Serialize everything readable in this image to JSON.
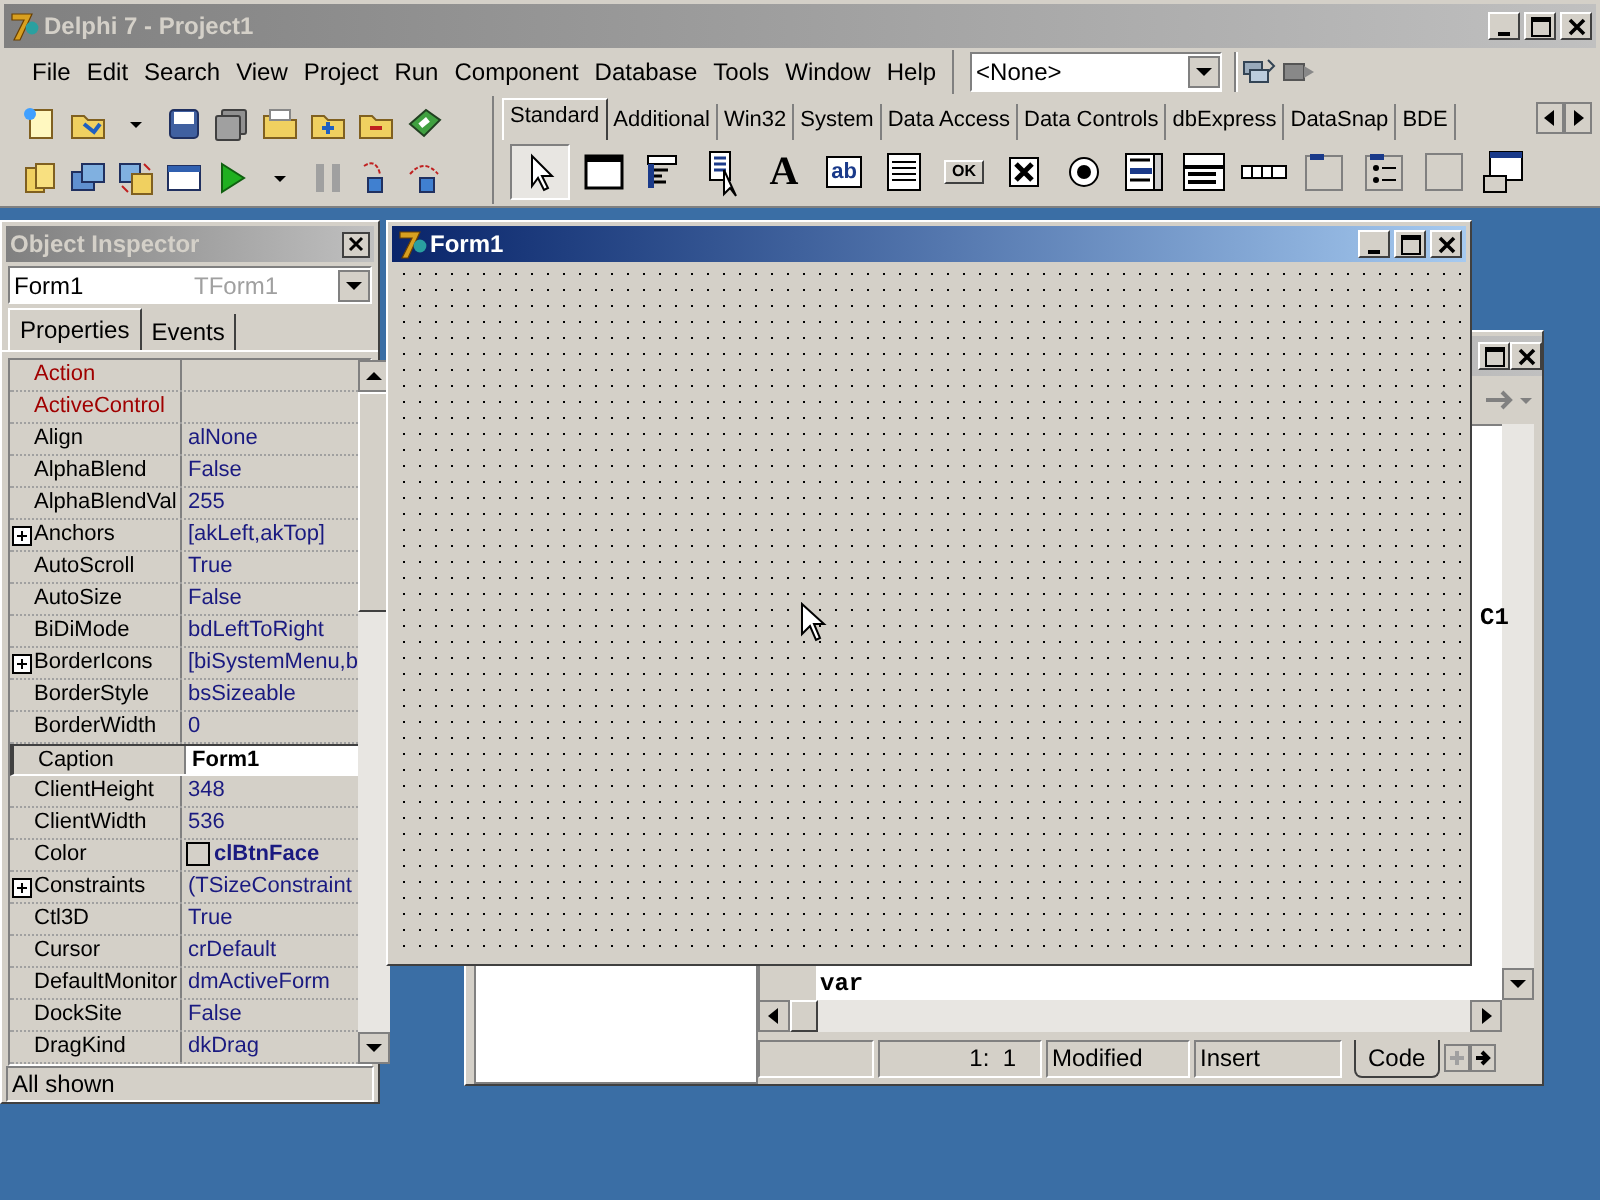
{
  "main_window": {
    "title": "Delphi 7 - Project1",
    "menu": [
      "File",
      "Edit",
      "Search",
      "View",
      "Project",
      "Run",
      "Component",
      "Database",
      "Tools",
      "Window",
      "Help"
    ],
    "component_combo": {
      "value": "<None>"
    },
    "palette_tabs": [
      {
        "label": "Standard",
        "selected": true
      },
      {
        "label": "Additional",
        "selected": false
      },
      {
        "label": "Win32",
        "selected": false
      },
      {
        "label": "System",
        "selected": false
      },
      {
        "label": "Data Access",
        "selected": false
      },
      {
        "label": "Data Controls",
        "selected": false
      },
      {
        "label": "dbExpress",
        "selected": false
      },
      {
        "label": "DataSnap",
        "selected": false
      },
      {
        "label": "BDE",
        "selected": false
      }
    ],
    "palette_components": [
      {
        "kind": "pointer",
        "selected": true
      },
      {
        "kind": "frame",
        "selected": false
      },
      {
        "kind": "menu",
        "selected": false
      },
      {
        "kind": "popup",
        "selected": false
      },
      {
        "kind": "label",
        "text": "A",
        "selected": false
      },
      {
        "kind": "edit",
        "text": "ab",
        "selected": false
      },
      {
        "kind": "memo",
        "selected": false
      },
      {
        "kind": "button",
        "text": "OK",
        "selected": false
      },
      {
        "kind": "checkbox",
        "selected": false
      },
      {
        "kind": "radio",
        "selected": false
      },
      {
        "kind": "listbox",
        "selected": false
      },
      {
        "kind": "combobox",
        "selected": false
      },
      {
        "kind": "scrollbar",
        "selected": false
      },
      {
        "kind": "groupbox",
        "selected": false
      },
      {
        "kind": "radiogroup",
        "selected": false
      },
      {
        "kind": "panel",
        "selected": false
      },
      {
        "kind": "actionlist",
        "selected": false
      }
    ]
  },
  "object_inspector": {
    "title": "Object Inspector",
    "selector": {
      "name": "Form1",
      "type": "TForm1"
    },
    "tabs": [
      {
        "label": "Properties",
        "selected": true
      },
      {
        "label": "Events",
        "selected": false
      }
    ],
    "properties": [
      {
        "name": "Action",
        "kind": "reference",
        "selected": false
      },
      {
        "name": "ActiveControl",
        "kind": "reference",
        "selected": false
      },
      {
        "name": "Align",
        "value": "alNone",
        "kind": "plain",
        "selected": false
      },
      {
        "name": "AlphaBlend",
        "value": "False",
        "kind": "plain",
        "selected": false
      },
      {
        "name": "AlphaBlendVal",
        "value": "255",
        "kind": "plain",
        "selected": false
      },
      {
        "name": "Anchors",
        "value": "[akLeft,akTop]",
        "kind": "expandable",
        "selected": false
      },
      {
        "name": "AutoScroll",
        "value": "True",
        "kind": "plain",
        "selected": false
      },
      {
        "name": "AutoSize",
        "value": "False",
        "kind": "plain",
        "selected": false
      },
      {
        "name": "BiDiMode",
        "value": "bdLeftToRight",
        "kind": "plain",
        "selected": false
      },
      {
        "name": "BorderIcons",
        "value": "[biSystemMenu,b",
        "kind": "expandable",
        "selected": false
      },
      {
        "name": "BorderStyle",
        "value": "bsSizeable",
        "kind": "plain",
        "selected": false
      },
      {
        "name": "BorderWidth",
        "value": "0",
        "kind": "plain",
        "selected": false
      },
      {
        "name": "Caption",
        "value": "Form1",
        "kind": "plain",
        "selected": true
      },
      {
        "name": "ClientHeight",
        "value": "348",
        "kind": "plain",
        "selected": false
      },
      {
        "name": "ClientWidth",
        "value": "536",
        "kind": "plain",
        "selected": false
      },
      {
        "name": "Color",
        "value": "clBtnFace",
        "kind": "color",
        "selected": false
      },
      {
        "name": "Constraints",
        "value": "(TSizeConstraint",
        "kind": "expandable",
        "selected": false
      },
      {
        "name": "Ctl3D",
        "value": "True",
        "kind": "plain",
        "selected": false
      },
      {
        "name": "Cursor",
        "value": "crDefault",
        "kind": "plain",
        "selected": false
      },
      {
        "name": "DefaultMonitor",
        "value": "dmActiveForm",
        "kind": "plain",
        "selected": false
      },
      {
        "name": "DockSite",
        "value": "False",
        "kind": "plain",
        "selected": false
      },
      {
        "name": "DragKind",
        "value": "dkDrag",
        "kind": "plain",
        "selected": false
      }
    ],
    "status": "All shown"
  },
  "form_window": {
    "title": "Form1"
  },
  "code_editor": {
    "code_lines": [
      "C1",
      "var"
    ],
    "status": {
      "position": "1:  1",
      "modified": "Modified",
      "mode": "Insert"
    },
    "tabs": [
      {
        "label": "Code",
        "selected": true
      }
    ]
  }
}
